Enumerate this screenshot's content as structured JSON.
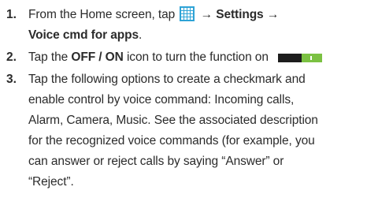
{
  "steps": [
    {
      "number": "1.",
      "line1_prefix": "From the Home screen, tap",
      "arrow1": "→",
      "settings": "Settings",
      "arrow2": "→",
      "voice_cmd": "Voice cmd for apps",
      "period": "."
    },
    {
      "number": "2.",
      "tap": "Tap the",
      "toggle_label": "OFF / ON",
      "suffix": "icon to turn the function on"
    },
    {
      "number": "3.",
      "lines": [
        "Tap the following options to create a checkmark and",
        "enable control by voice command: Incoming calls,",
        "Alarm, Camera, Music. See the associated description",
        "for the recognized voice commands (for example, you",
        "can answer or reject calls by saying “Answer” or",
        "“Reject”."
      ]
    }
  ],
  "icons": {
    "apps_icon": "apps-grid-icon",
    "apps_icon_color": "#2ea3d6",
    "toggle_icon": "on-off-toggle-icon",
    "toggle_on_color": "#7bc142",
    "toggle_off_color": "#1d1d1d"
  }
}
